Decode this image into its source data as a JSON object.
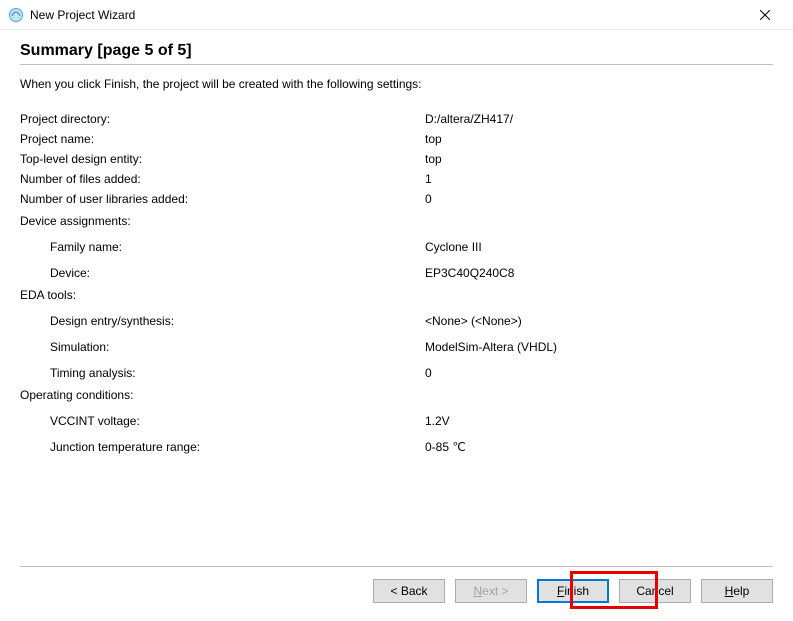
{
  "window": {
    "title": "New Project Wizard"
  },
  "page": {
    "heading": "Summary [page 5 of 5]",
    "instruction": "When you click Finish, the project will be created with the following settings:"
  },
  "summary": {
    "project_directory_label": "Project directory:",
    "project_directory_value": "D:/altera/ZH417/",
    "project_name_label": "Project name:",
    "project_name_value": "top",
    "top_entity_label": "Top-level design entity:",
    "top_entity_value": "top",
    "num_files_label": "Number of files added:",
    "num_files_value": "1",
    "num_libs_label": "Number of user libraries added:",
    "num_libs_value": "0",
    "device_assign_label": "Device assignments:",
    "family_label": "Family name:",
    "family_value": "Cyclone III",
    "device_label": "Device:",
    "device_value": "EP3C40Q240C8",
    "eda_label": "EDA tools:",
    "design_entry_label": "Design entry/synthesis:",
    "design_entry_value": "<None> (<None>)",
    "simulation_label": "Simulation:",
    "simulation_value": "ModelSim-Altera (VHDL)",
    "timing_label": "Timing analysis:",
    "timing_value": "0",
    "opcond_label": "Operating conditions:",
    "vccint_label": "VCCINT voltage:",
    "vccint_value": "1.2V",
    "junction_label": "Junction temperature range:",
    "junction_value": "0-85 ℃"
  },
  "buttons": {
    "back": "< Back",
    "next_prefix": "N",
    "next_suffix": "ext >",
    "finish_prefix": "F",
    "finish_suffix": "inish",
    "cancel": "Cancel",
    "help_prefix": "H",
    "help_suffix": "elp"
  }
}
